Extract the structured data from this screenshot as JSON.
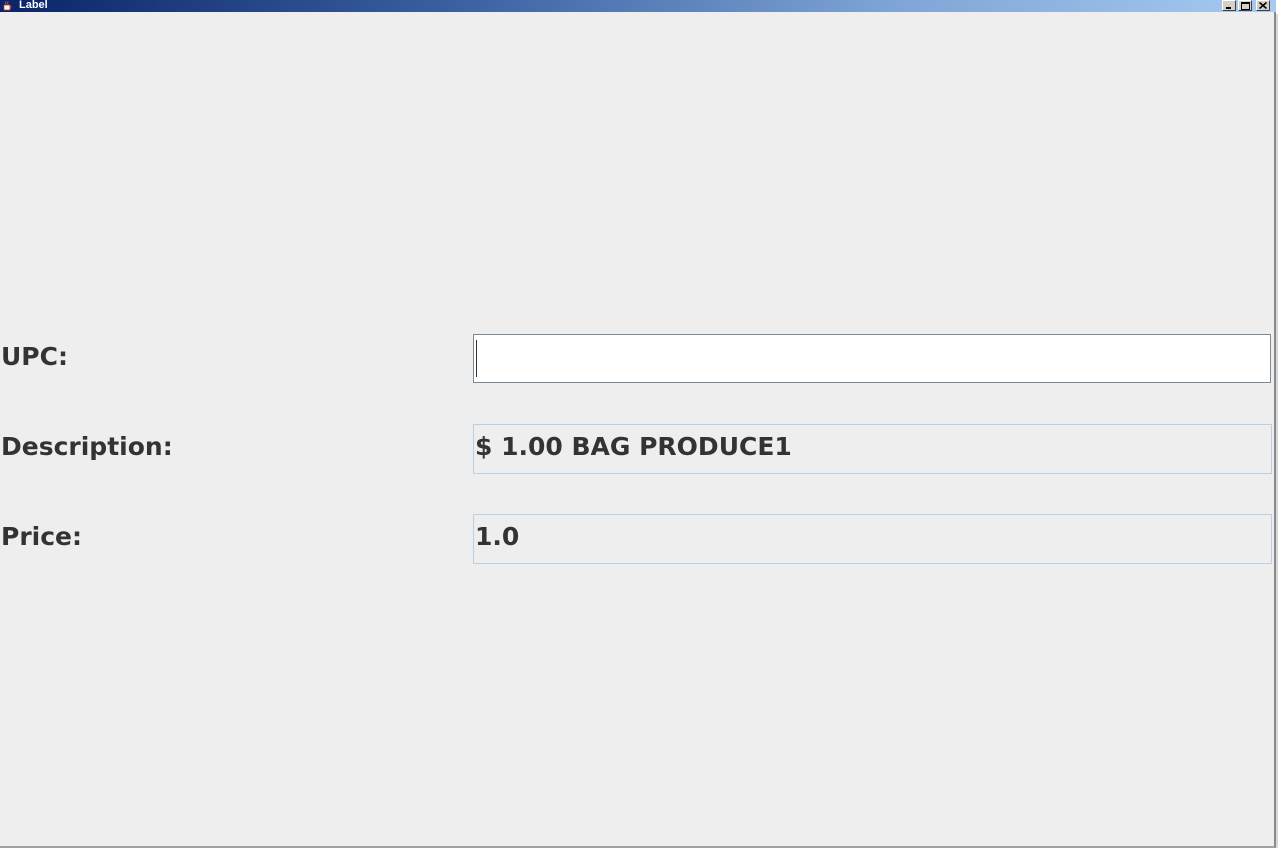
{
  "window": {
    "title": "Label",
    "icon": "java-cup-icon",
    "controls": {
      "minimize_icon": "minimize-icon",
      "maximize_icon": "maximize-icon",
      "close_icon": "close-icon"
    }
  },
  "form": {
    "upc": {
      "label": "UPC:",
      "value": "",
      "placeholder": ""
    },
    "description": {
      "label": "Description:",
      "value": "$ 1.00 BAG PRODUCE1"
    },
    "price": {
      "label": "Price:",
      "value": "1.0"
    }
  },
  "colors": {
    "titlebar_start": "#0a246a",
    "titlebar_end": "#a6caf0",
    "background": "#eeeeee",
    "text": "#333333",
    "field_border": "#b8cfe5"
  }
}
